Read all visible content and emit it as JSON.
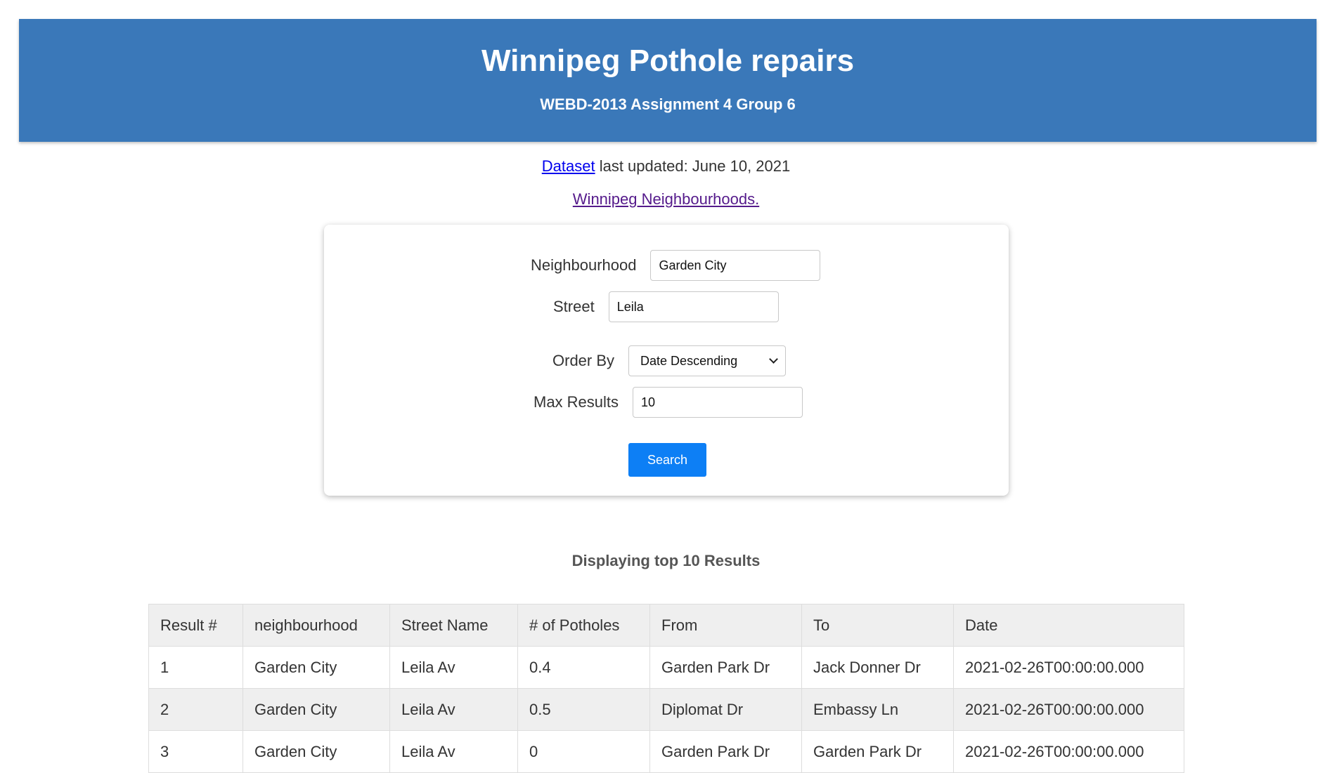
{
  "header": {
    "title": "Winnipeg Pothole repairs",
    "subtitle": "WEBD-2013 Assignment 4 Group 6"
  },
  "meta": {
    "dataset_link": "Dataset",
    "updated_text": " last updated: June 10, 2021",
    "neighbourhoods_link": "Winnipeg Neighbourhoods."
  },
  "form": {
    "neighbourhood_label": "Neighbourhood",
    "neighbourhood_value": "Garden City",
    "street_label": "Street",
    "street_value": "Leila",
    "order_label": "Order By",
    "order_value": "Date Descending",
    "max_label": "Max Results",
    "max_value": "10",
    "search_label": "Search"
  },
  "results": {
    "title": "Displaying top 10 Results",
    "columns": [
      "Result #",
      "neighbourhood",
      "Street Name",
      "# of Potholes",
      "From",
      "To",
      "Date"
    ],
    "rows": [
      [
        "1",
        "Garden City",
        "Leila Av",
        "0.4",
        "Garden Park Dr",
        "Jack Donner Dr",
        "2021-02-26T00:00:00.000"
      ],
      [
        "2",
        "Garden City",
        "Leila Av",
        "0.5",
        "Diplomat Dr",
        "Embassy Ln",
        "2021-02-26T00:00:00.000"
      ],
      [
        "3",
        "Garden City",
        "Leila Av",
        "0",
        "Garden Park Dr",
        "Garden Park Dr",
        "2021-02-26T00:00:00.000"
      ]
    ]
  }
}
